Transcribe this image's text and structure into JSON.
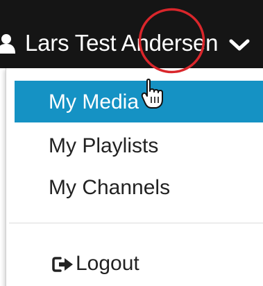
{
  "navbar": {
    "user_name": "Lars Test Andersen",
    "user_icon": "user-icon",
    "toggle_icon": "chevron-down-icon",
    "background_color": "#151515"
  },
  "dropdown": {
    "items": [
      {
        "label": "My Media",
        "active": true
      },
      {
        "label": "My Playlists",
        "active": false
      },
      {
        "label": "My Channels",
        "active": false
      }
    ],
    "logout": {
      "icon": "sign-out-icon",
      "label": "Logout"
    },
    "active_color": "#1592c4"
  },
  "annotation": {
    "highlight_color": "#d9262b",
    "cursor_icon": "hand-pointer-icon"
  }
}
